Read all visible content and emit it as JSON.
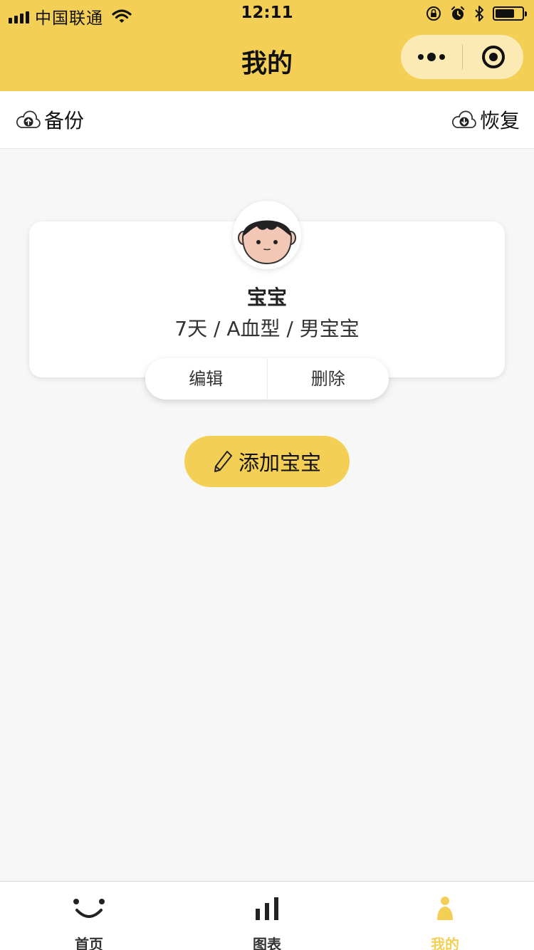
{
  "status_bar": {
    "carrier": "中国联通",
    "time": "12:11"
  },
  "nav": {
    "title": "我的"
  },
  "actions": {
    "backup_label": "备份",
    "restore_label": "恢复"
  },
  "baby_card": {
    "name": "宝宝",
    "info": "7天 / A血型 / 男宝宝",
    "edit_label": "编辑",
    "delete_label": "删除"
  },
  "add_button": {
    "label": "添加宝宝"
  },
  "tabs": [
    {
      "label": "首页",
      "icon": "smile-icon",
      "active": false
    },
    {
      "label": "图表",
      "icon": "bar-chart-icon",
      "active": false
    },
    {
      "label": "我的",
      "icon": "person-icon",
      "active": true
    }
  ],
  "colors": {
    "accent": "#f4cf55",
    "capsule": "#fbeab3",
    "background": "#f7f7f7"
  },
  "battery_level": 0.72
}
